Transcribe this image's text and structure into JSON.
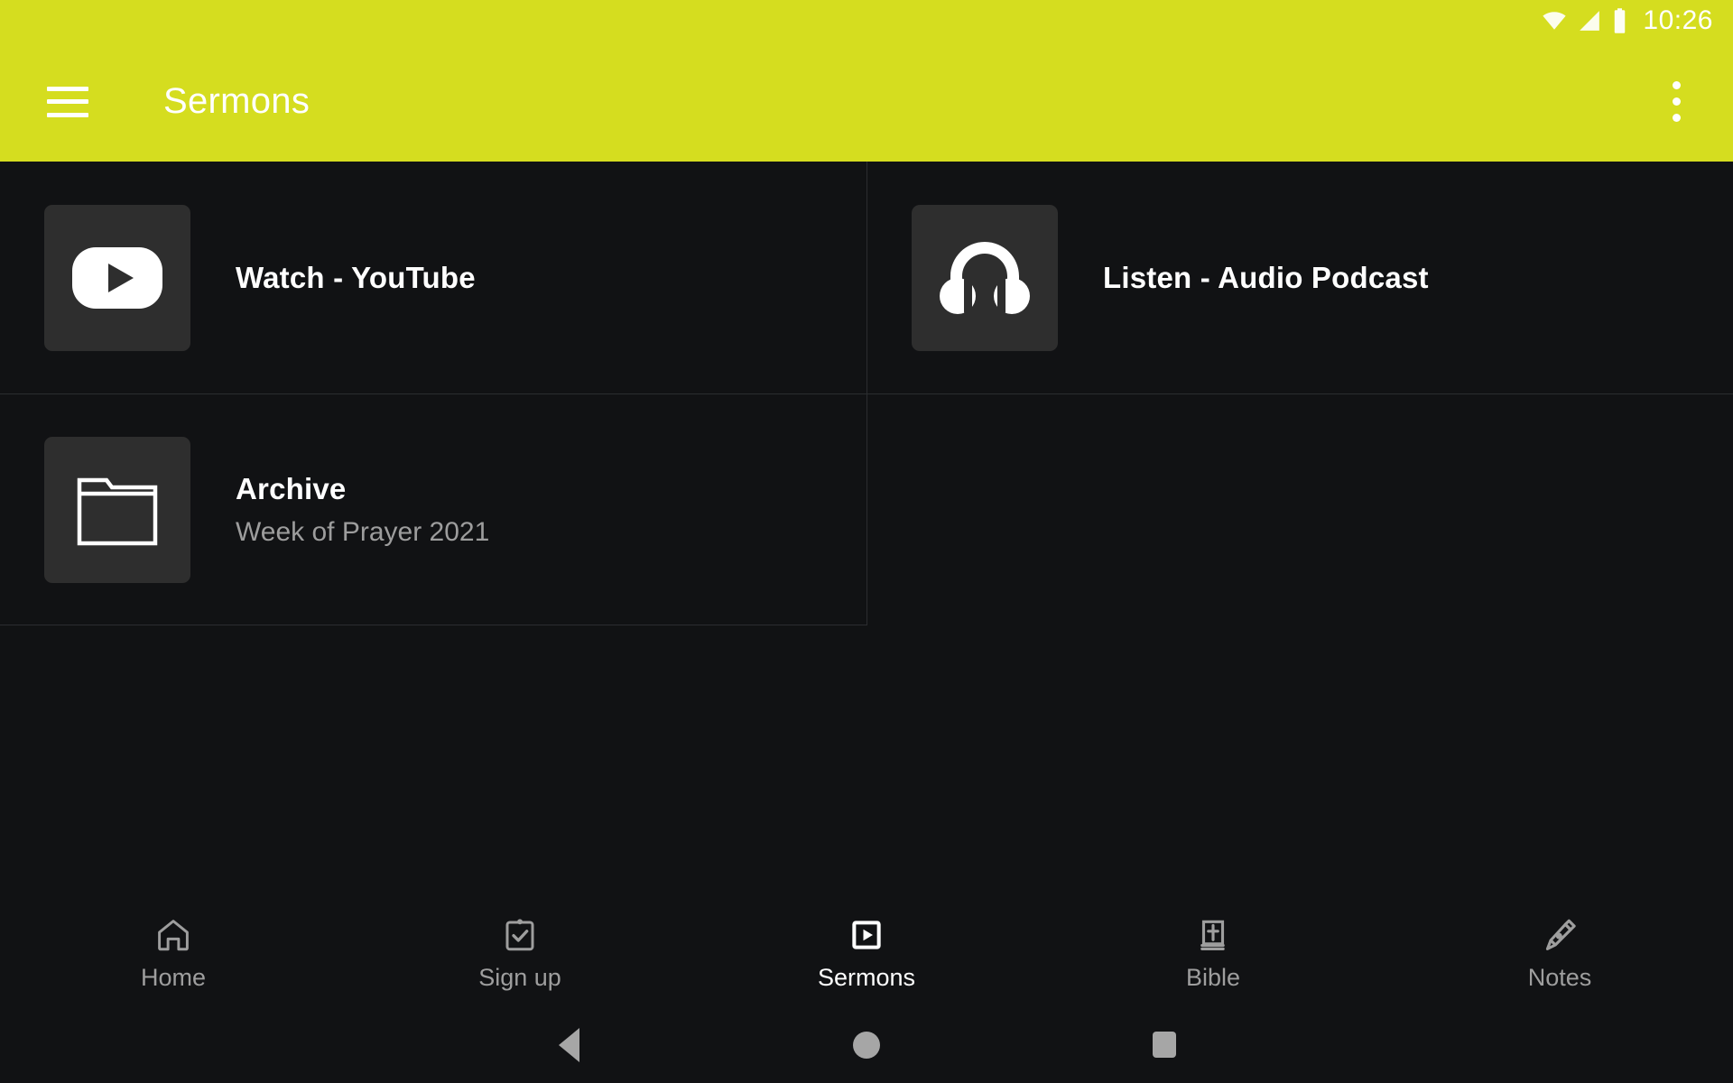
{
  "statusbar": {
    "time": "10:26",
    "icons": [
      "wifi-icon",
      "signal-icon",
      "battery-icon"
    ]
  },
  "appbar": {
    "menu_icon": "hamburger-menu-icon",
    "title": "Sermons",
    "overflow_icon": "more-vert-icon",
    "background_color": "#d5dd1f",
    "title_color": "#ffffff"
  },
  "content": {
    "background_color": "#111214",
    "tile_icon_background": "#2e2e2e",
    "divider_color": "#2b2d30",
    "tiles": [
      {
        "title": "Watch - YouTube",
        "subtitle": "",
        "icon": "youtube-play-icon"
      },
      {
        "title": "Listen - Audio Podcast",
        "subtitle": "",
        "icon": "headphones-icon"
      },
      {
        "title": "Archive",
        "subtitle": "Week of Prayer 2021",
        "icon": "folder-icon"
      }
    ]
  },
  "bottomnav": {
    "active_index": 2,
    "active_color": "#ffffff",
    "inactive_color": "#9e9e9e",
    "items": [
      {
        "label": "Home",
        "icon": "home-icon"
      },
      {
        "label": "Sign up",
        "icon": "clipboard-check-icon"
      },
      {
        "label": "Sermons",
        "icon": "video-play-square-icon"
      },
      {
        "label": "Bible",
        "icon": "book-cross-icon"
      },
      {
        "label": "Notes",
        "icon": "pen-nib-icon"
      }
    ]
  },
  "sysnav": {
    "color": "#a6a6a6",
    "buttons": [
      {
        "name": "back-button",
        "icon": "triangle-back-icon"
      },
      {
        "name": "home-button",
        "icon": "circle-home-icon"
      },
      {
        "name": "recents-button",
        "icon": "square-recents-icon"
      }
    ]
  }
}
